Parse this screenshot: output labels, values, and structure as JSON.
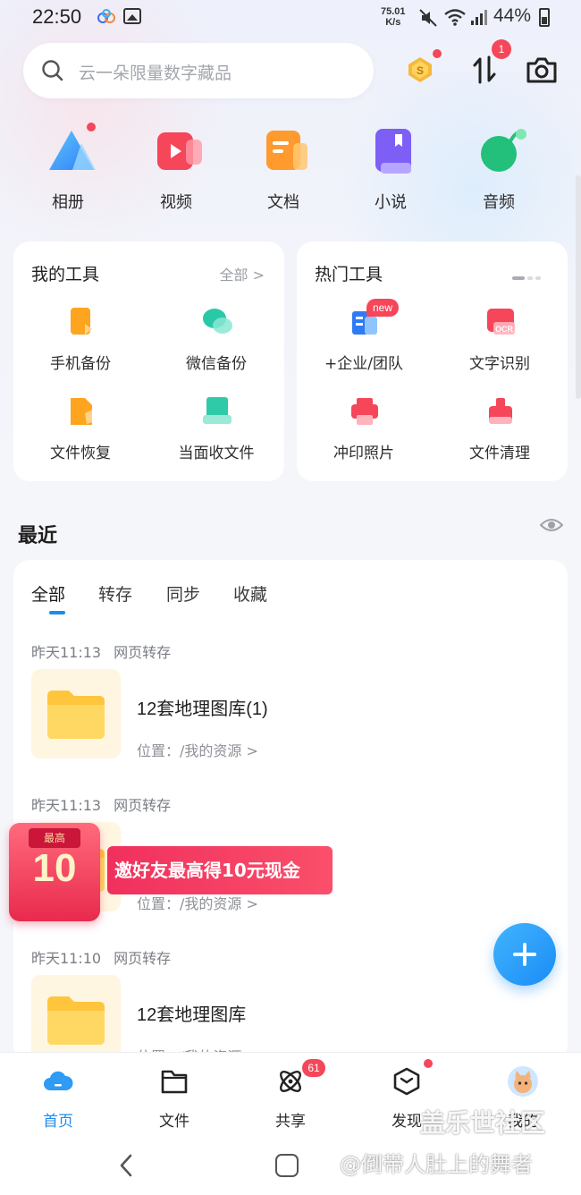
{
  "status": {
    "time": "22:50",
    "net_speed_value": "75.01",
    "net_speed_unit": "K/s",
    "battery": "44%"
  },
  "search": {
    "placeholder": "云一朵限量数字藏品"
  },
  "header": {
    "transfer_badge": "1"
  },
  "categories": [
    {
      "label": "相册",
      "icon": "photo-album-icon"
    },
    {
      "label": "视频",
      "icon": "video-icon"
    },
    {
      "label": "文档",
      "icon": "document-icon"
    },
    {
      "label": "小说",
      "icon": "novel-icon"
    },
    {
      "label": "音频",
      "icon": "audio-icon"
    }
  ],
  "my_tools": {
    "title": "我的工具",
    "more": "全部 >",
    "items": [
      {
        "label": "手机备份",
        "icon": "phone-backup-icon"
      },
      {
        "label": "微信备份",
        "icon": "wechat-backup-icon"
      },
      {
        "label": "文件恢复",
        "icon": "file-recovery-icon"
      },
      {
        "label": "当面收文件",
        "icon": "receive-file-icon"
      }
    ]
  },
  "hot_tools": {
    "title": "热门工具",
    "new_badge": "new",
    "items": [
      {
        "label": "+企业/团队",
        "icon": "enterprise-icon"
      },
      {
        "label": "文字识别",
        "icon": "ocr-icon",
        "icon_text": "OCR"
      },
      {
        "label": "冲印照片",
        "icon": "print-photo-icon"
      },
      {
        "label": "文件清理",
        "icon": "file-clean-icon"
      }
    ]
  },
  "recent": {
    "title": "最近",
    "tabs": [
      "全部",
      "转存",
      "同步",
      "收藏"
    ],
    "active_tab": 0,
    "items": [
      {
        "time": "昨天11:13",
        "source": "网页转存",
        "name": "12套地理图库(1)",
        "location": "位置：/我的资源 >"
      },
      {
        "time": "昨天11:13",
        "source": "网页转存",
        "name": "",
        "location": "位置：/我的资源 >"
      },
      {
        "time": "昨天11:10",
        "source": "网页转存",
        "name": "12套地理图库",
        "location": "位置：/我的资源 >"
      }
    ]
  },
  "promo": {
    "envelope_top": "最高",
    "envelope_amount": "10",
    "text": "邀好友最高得10元现金"
  },
  "bottom_nav": {
    "items": [
      {
        "label": "首页",
        "icon": "home-cloud-icon",
        "active": true
      },
      {
        "label": "文件",
        "icon": "folder-icon"
      },
      {
        "label": "共享",
        "icon": "share-atom-icon"
      },
      {
        "label": "发现",
        "icon": "discover-cube-icon"
      },
      {
        "label": "我的",
        "icon": "avatar-icon"
      }
    ],
    "share_badge": "61"
  },
  "watermark": {
    "line1": "盖乐世社区",
    "line2": "@倒带人肚上的舞者"
  },
  "colors": {
    "accent": "#1c8bf0",
    "badge": "#f5465a",
    "promo": "#f0305e"
  }
}
